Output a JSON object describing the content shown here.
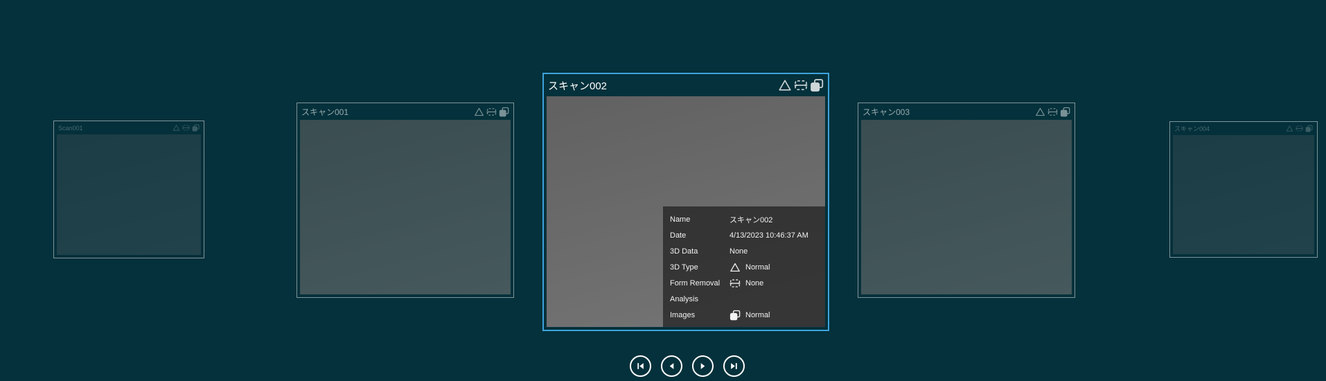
{
  "colors": {
    "background": "#04313b",
    "selection_border": "#3fa3dc",
    "card_border": "#7e959c",
    "tooltip_background": "rgba(30,30,30,0.72)"
  },
  "icons": {
    "triangle": "3d-type (outlined triangle)",
    "form_removal": "form-removal (dashed split rectangle)",
    "images": "images (overlapping squares)",
    "nav_first": "skip-to-first",
    "nav_previous": "previous",
    "nav_next": "next",
    "nav_last": "skip-to-last"
  },
  "cards": [
    {
      "title": "Scan001",
      "state": "dimmed-far"
    },
    {
      "title": "スキャン001",
      "state": "dimmed-near"
    },
    {
      "title": "スキャン002",
      "state": "selected"
    },
    {
      "title": "スキャン003",
      "state": "dimmed-near"
    },
    {
      "title": "スキャン004",
      "state": "dimmed-far"
    }
  ],
  "tooltip": {
    "rows": [
      {
        "label": "Name",
        "value": "スキャン002"
      },
      {
        "label": "Date",
        "value": "4/13/2023 10:46:37 AM"
      },
      {
        "label": "3D Data",
        "value": "None"
      },
      {
        "label": "3D Type",
        "value": "Normal",
        "icon": "triangle-icon"
      },
      {
        "label": "Form Removal",
        "value": "None",
        "icon": "form-removal-icon"
      },
      {
        "label": "Analysis",
        "value": ""
      },
      {
        "label": "Images",
        "value": "Normal",
        "icon": "images-icon"
      }
    ]
  }
}
